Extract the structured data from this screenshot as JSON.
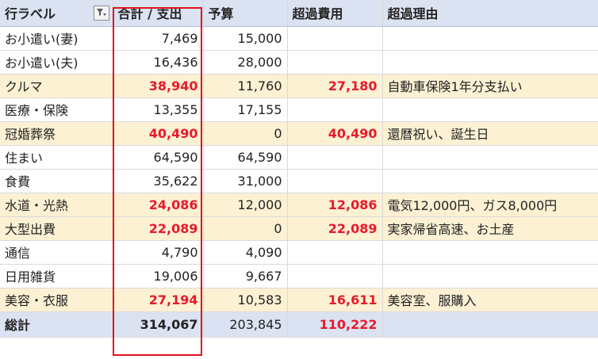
{
  "header": {
    "row_label": "行ラベル",
    "total_expense": "合計 / 支出",
    "budget": "予算",
    "over_cost": "超過費用",
    "over_reason": "超過理由"
  },
  "rows": [
    {
      "label": "お小遣い(妻)",
      "expense": "7,469",
      "budget": "15,000",
      "over": "",
      "reason": ""
    },
    {
      "label": "お小遣い(夫)",
      "expense": "16,436",
      "budget": "28,000",
      "over": "",
      "reason": ""
    },
    {
      "label": "クルマ",
      "expense": "38,940",
      "budget": "11,760",
      "over": "27,180",
      "reason": "自動車保険1年分支払い"
    },
    {
      "label": "医療・保険",
      "expense": "13,355",
      "budget": "17,155",
      "over": "",
      "reason": ""
    },
    {
      "label": "冠婚葬祭",
      "expense": "40,490",
      "budget": "0",
      "over": "40,490",
      "reason": "還暦祝い、誕生日"
    },
    {
      "label": "住まい",
      "expense": "64,590",
      "budget": "64,590",
      "over": "",
      "reason": ""
    },
    {
      "label": "食費",
      "expense": "35,622",
      "budget": "31,000",
      "over": "",
      "reason": ""
    },
    {
      "label": "水道・光熱",
      "expense": "24,086",
      "budget": "12,000",
      "over": "12,086",
      "reason": "電気12,000円、ガス8,000円"
    },
    {
      "label": "大型出費",
      "expense": "22,089",
      "budget": "0",
      "over": "22,089",
      "reason": "実家帰省高速、お土産"
    },
    {
      "label": "通信",
      "expense": "4,790",
      "budget": "4,090",
      "over": "",
      "reason": ""
    },
    {
      "label": "日用雑貨",
      "expense": "19,006",
      "budget": "9,667",
      "over": "",
      "reason": ""
    },
    {
      "label": "美容・衣服",
      "expense": "27,194",
      "budget": "10,583",
      "over": "16,611",
      "reason": "美容室、服購入"
    }
  ],
  "total": {
    "label": "総計",
    "expense": "314,067",
    "budget": "203,845",
    "over": "110,222",
    "reason": ""
  },
  "colors": {
    "over_row_bg": "#fdf1d4",
    "header_bg": "#dbe2f1",
    "accent_red": "#e8192c",
    "highlight_border": "#e0141e"
  }
}
